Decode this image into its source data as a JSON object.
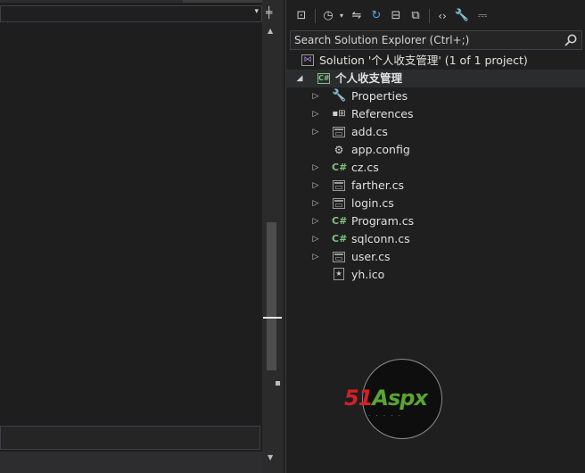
{
  "editor": {
    "navigation_dropdown": {
      "value": ""
    },
    "bottom_field": {
      "value": ""
    }
  },
  "solution_explorer": {
    "toolbar": [
      {
        "icon": "switch-views-icon"
      },
      {
        "icon": "pending-changes-filter-icon"
      },
      {
        "icon": "dropdown-arrow-icon"
      },
      {
        "icon": "sync-with-active-document-icon"
      },
      {
        "icon": "refresh-icon"
      },
      {
        "icon": "collapse-all-icon"
      },
      {
        "icon": "show-all-files-icon"
      },
      {
        "icon": "view-code-icon"
      },
      {
        "icon": "properties-icon"
      },
      {
        "icon": "preview-selected-items-icon"
      }
    ],
    "search": {
      "placeholder": "Search Solution Explorer (Ctrl+;)"
    },
    "tree": {
      "solution": "Solution '个人收支管理' (1 of 1 project)",
      "project": "个人收支管理",
      "items": [
        {
          "label": "Properties",
          "icon": "wrench-icon",
          "expandable": true
        },
        {
          "label": "References",
          "icon": "references-icon",
          "expandable": true
        },
        {
          "label": "add.cs",
          "icon": "form-file-icon",
          "expandable": true
        },
        {
          "label": "app.config",
          "icon": "config-file-icon",
          "expandable": false
        },
        {
          "label": "cz.cs",
          "icon": "csharp-file-icon",
          "expandable": true
        },
        {
          "label": "farther.cs",
          "icon": "form-file-icon",
          "expandable": true
        },
        {
          "label": "login.cs",
          "icon": "form-file-icon",
          "expandable": true
        },
        {
          "label": "Program.cs",
          "icon": "csharp-file-icon",
          "expandable": true
        },
        {
          "label": "sqlconn.cs",
          "icon": "csharp-file-icon",
          "expandable": true
        },
        {
          "label": "user.cs",
          "icon": "form-file-icon",
          "expandable": true
        },
        {
          "label": "yh.ico",
          "icon": "icon-file-icon",
          "expandable": false
        }
      ]
    }
  },
  "watermark": {
    "brand_number": "51",
    "brand_name": "Aspx"
  },
  "colors": {
    "background": "#1f1f1f",
    "text": "#e0e0e0",
    "csharp_green": "#7ec27e",
    "accent_blue": "#4fa3e6",
    "watermark_red": "#d41f26",
    "watermark_green": "#5aa532"
  }
}
